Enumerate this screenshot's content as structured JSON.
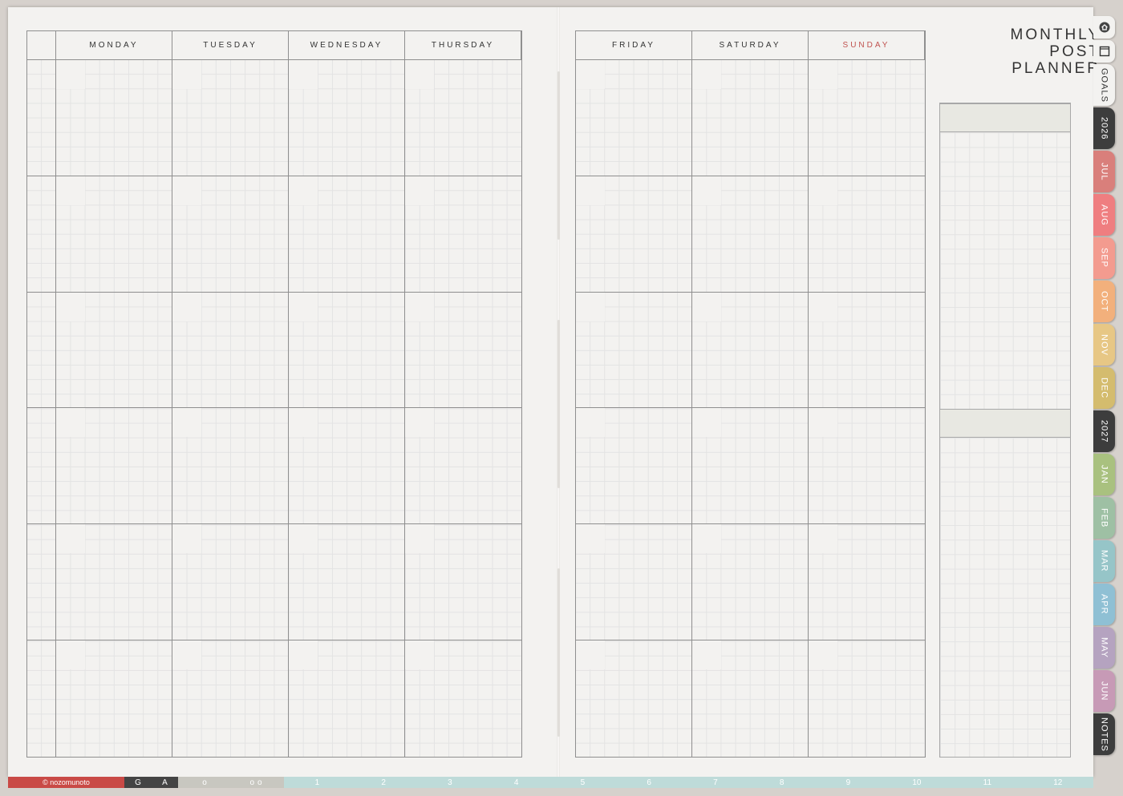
{
  "title": {
    "line1": "MONTHLY",
    "line2": "POST",
    "line3": "PLANNER"
  },
  "days_left": [
    "MONDAY",
    "TUESDAY",
    "WEDNESDAY",
    "THURSDAY"
  ],
  "days_right": [
    "FRIDAY",
    "SATURDAY",
    "SUNDAY"
  ],
  "sunday_color": "#c0524f",
  "side_tabs": [
    {
      "label": "GOALS",
      "color": "#f3f2f0"
    },
    {
      "label": "2026",
      "color": "#3d3d3d"
    },
    {
      "label": "JUL",
      "color": "#d97f7b"
    },
    {
      "label": "AUG",
      "color": "#ef7e80"
    },
    {
      "label": "SEP",
      "color": "#f39b8f"
    },
    {
      "label": "OCT",
      "color": "#f2b07c"
    },
    {
      "label": "NOV",
      "color": "#e7c785"
    },
    {
      "label": "DEC",
      "color": "#d4bc6e"
    },
    {
      "label": "2027",
      "color": "#3d3d3d"
    },
    {
      "label": "JAN",
      "color": "#a9c17f"
    },
    {
      "label": "FEB",
      "color": "#9ec0a4"
    },
    {
      "label": "MAR",
      "color": "#96c5c8"
    },
    {
      "label": "APR",
      "color": "#8fc0d4"
    },
    {
      "label": "MAY",
      "color": "#b5a3c0"
    },
    {
      "label": "JUN",
      "color": "#c79ab6"
    },
    {
      "label": "NOTES",
      "color": "#3d3d3d"
    }
  ],
  "bottom": {
    "brand": "© nozomunoto",
    "g": "G",
    "a": "A",
    "o1": "o",
    "o2": "oo",
    "months": [
      "1",
      "2",
      "3",
      "4",
      "5",
      "6",
      "7",
      "8",
      "9",
      "10",
      "11",
      "12"
    ]
  }
}
